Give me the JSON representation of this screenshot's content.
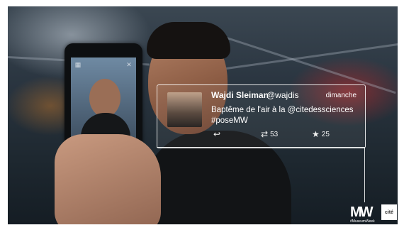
{
  "tweet": {
    "author_name": "Wajdi Sleiman",
    "author_handle": "@wajdis",
    "date": "dimanche",
    "text_line1": "Baptême de l'air à la @citedessciences",
    "text_line2": "#poseMW",
    "retweets": "53",
    "favorites": "25"
  },
  "icons": {
    "reply": "reply-icon",
    "retweet": "retweet-icon",
    "favorite": "star-icon"
  },
  "branding": {
    "logo_text": "MW",
    "hashtag": "#MuseumWeek"
  },
  "colors": {
    "overlay_text": "#ffffff",
    "record_button": "#e33333"
  }
}
